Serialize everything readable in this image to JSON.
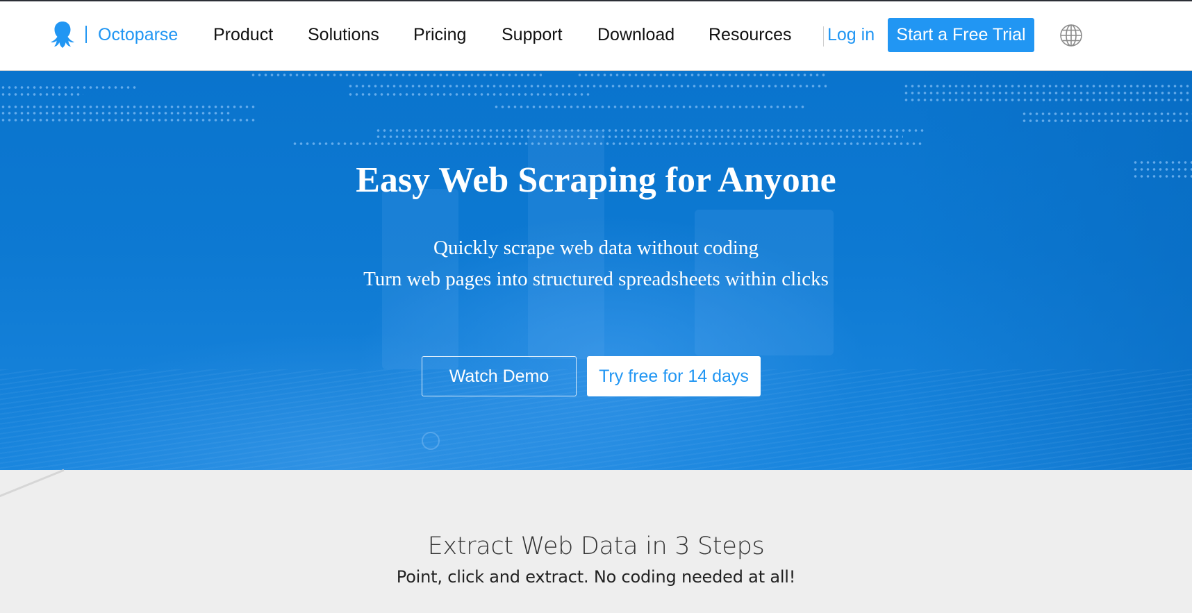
{
  "nav": {
    "brand": "Octoparse",
    "logo_icon": "octopus-logo-icon",
    "items": [
      {
        "label": "Product"
      },
      {
        "label": "Solutions"
      },
      {
        "label": "Pricing"
      },
      {
        "label": "Support"
      },
      {
        "label": "Download"
      },
      {
        "label": "Resources"
      }
    ],
    "login_label": "Log in",
    "trial_label": "Start a Free Trial",
    "language_icon": "globe-icon"
  },
  "hero": {
    "title": "Easy Web Scraping for Anyone",
    "subtitle_line1": "Quickly scrape web data without coding",
    "subtitle_line2": "Turn web pages into structured spreadsheets within clicks",
    "watch_demo_label": "Watch Demo",
    "try_free_label": "Try free for 14 days"
  },
  "steps": {
    "title": "Extract Web Data in 3 Steps",
    "subtitle": "Point, click and extract. No coding needed at all!"
  },
  "colors": {
    "brand_blue": "#2196f3",
    "hero_blue": "#0d79d2",
    "section_bg": "#eeeeee",
    "nav_text": "#111111"
  }
}
